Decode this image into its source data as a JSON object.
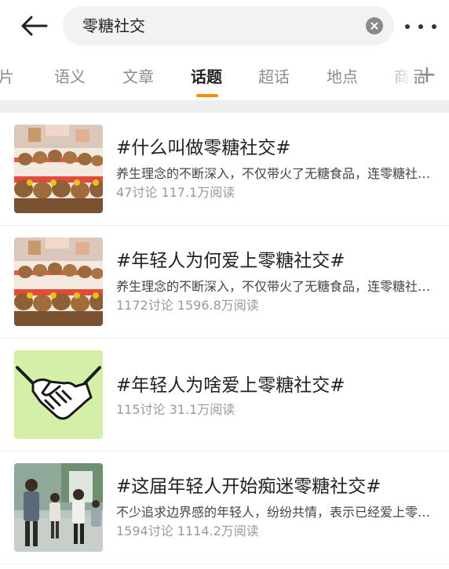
{
  "header": {
    "search_query": "零糖社交",
    "back_icon": "arrow-left-icon",
    "clear_icon": "clear-circle-icon",
    "more_icon": "more-dots-icon"
  },
  "tabs": {
    "items": [
      {
        "label": "图片"
      },
      {
        "label": "语义"
      },
      {
        "label": "文章"
      },
      {
        "label": "话题"
      },
      {
        "label": "超话"
      },
      {
        "label": "地点"
      },
      {
        "label": "商品"
      }
    ],
    "active_index": 3,
    "add_label": "+",
    "accent_color": "#ff8a00"
  },
  "topics": [
    {
      "title": "#什么叫做零糖社交#",
      "desc": "养生理念的不断深入，不仅带火了无糖食品，连零糖社交也火了",
      "stats": "47讨论 117.1万阅读",
      "thumb": "plush-toys"
    },
    {
      "title": "#年轻人为何爱上零糖社交#",
      "desc": "养生理念的不断深入，不仅带火了无糖食品，连零糖社交也火了",
      "stats": "1172讨论 1596.8万阅读",
      "thumb": "plush-toys"
    },
    {
      "title": "#年轻人为啥爱上零糖社交#",
      "stats": "115讨论 31.1万阅读",
      "thumb": "handshake"
    },
    {
      "title": "#这届年轻人开始痴迷零糖社交#",
      "desc": "不少追求边界感的年轻人，纷纷共情，表示已经爱上零糖社交",
      "stats": "1594讨论 1114.2万阅读",
      "thumb": "people-photo"
    }
  ]
}
